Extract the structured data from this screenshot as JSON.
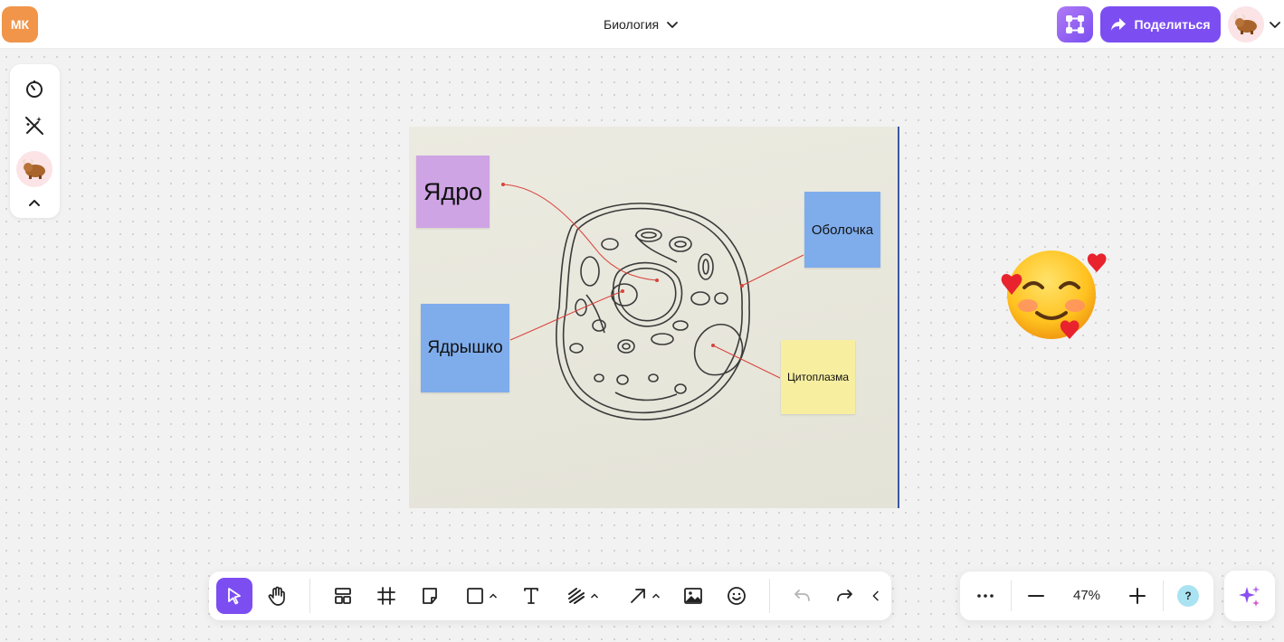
{
  "header": {
    "initials": "МК",
    "board_title": "Биология",
    "share_label": "Поделиться",
    "avatar_icon": "yak-avatar-icon"
  },
  "left_panel": {
    "items": [
      "timer-icon",
      "magic-wand-off-icon",
      "yak-avatar-icon",
      "chevron-up-icon"
    ]
  },
  "canvas": {
    "image_description_icon": "cell-drawing",
    "stickies": [
      {
        "label": "Ядро",
        "color": "#cfa4e4"
      },
      {
        "label": "Оболочка",
        "color": "#7fadec"
      },
      {
        "label": "Ядрышко",
        "color": "#7fadec"
      },
      {
        "label": "Цитоплазма",
        "color": "#f7eea0"
      }
    ],
    "sticker": "smiling-face-with-hearts-emoji"
  },
  "toolbar": {
    "tools": [
      "select",
      "hand",
      "templates",
      "frame",
      "sticky-note",
      "shape",
      "text",
      "pen",
      "arrow",
      "image",
      "emoji",
      "undo",
      "redo",
      "collapse"
    ]
  },
  "zoom": {
    "level": "47%",
    "help_label": "?"
  },
  "colors": {
    "accent": "#7c4ef2",
    "initials_bg": "#f0954a"
  }
}
